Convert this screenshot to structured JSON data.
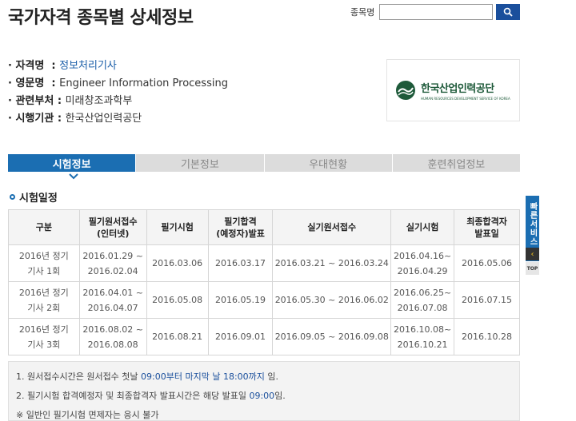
{
  "page": {
    "title": "국가자격 종목별 상세정보"
  },
  "search": {
    "label": "종목명",
    "value": "",
    "placeholder": ""
  },
  "info": [
    {
      "key": "· 자격명  : ",
      "value": "정보처리기사"
    },
    {
      "key": "· 영문명  : ",
      "value": "Engineer Information Processing"
    },
    {
      "key": "· 관련부처 : ",
      "value": "미래창조과학부"
    },
    {
      "key": "· 시행기관 : ",
      "value": "한국산업인력공단"
    }
  ],
  "logo": {
    "name": "한국산업인력공단",
    "sub": "HUMAN RESOURCES DEVELOPMENT SERVICE OF KOREA"
  },
  "tabs": [
    {
      "label": "시험정보",
      "active": true
    },
    {
      "label": "기본정보",
      "active": false
    },
    {
      "label": "우대현황",
      "active": false
    },
    {
      "label": "훈련취업정보",
      "active": false
    }
  ],
  "section": {
    "title": "시험일정"
  },
  "schedule": {
    "headers": [
      "구분",
      "필기원서접수\n(인터넷)",
      "필기시험",
      "필기합격\n(예정자)발표",
      "실기원서접수",
      "실기시험",
      "최종합격자\n발표일"
    ],
    "rows": [
      [
        "2016년 정기\n기사 1회",
        "2016.01.29 ~\n2016.02.04",
        "2016.03.06",
        "2016.03.17",
        "2016.03.21 ~ 2016.03.24",
        "2016.04.16~\n2016.04.29",
        "2016.05.06"
      ],
      [
        "2016년 정기\n기사 2회",
        "2016.04.01 ~\n2016.04.07",
        "2016.05.08",
        "2016.05.19",
        "2016.05.30 ~ 2016.06.02",
        "2016.06.25~\n2016.07.08",
        "2016.07.15"
      ],
      [
        "2016년 정기\n기사 3회",
        "2016.08.02 ~\n2016.08.08",
        "2016.08.21",
        "2016.09.01",
        "2016.09.05 ~ 2016.09.08",
        "2016.10.08~\n2016.10.21",
        "2016.10.28"
      ]
    ]
  },
  "notes": {
    "n1_a": "1. 원서접수시간은 원서접수 첫날 ",
    "n1_b": "09:00부터 마지막 날 18:00까지",
    "n1_c": " 임.",
    "n2_a": "2. 필기시험 합격예정자 및 최종합격자 발표시간은 해당 발표일 ",
    "n2_b": "09:00",
    "n2_c": "임.",
    "n3": "※ 일반인 필기시험 면제자는 응시 불가"
  },
  "quick": {
    "label": "빠른서비스",
    "top_label": "TOP"
  },
  "colors": {
    "accent": "#1b6eb2",
    "tab_inactive": "#dcdcdc",
    "logo_green": "#1e5a3a"
  }
}
